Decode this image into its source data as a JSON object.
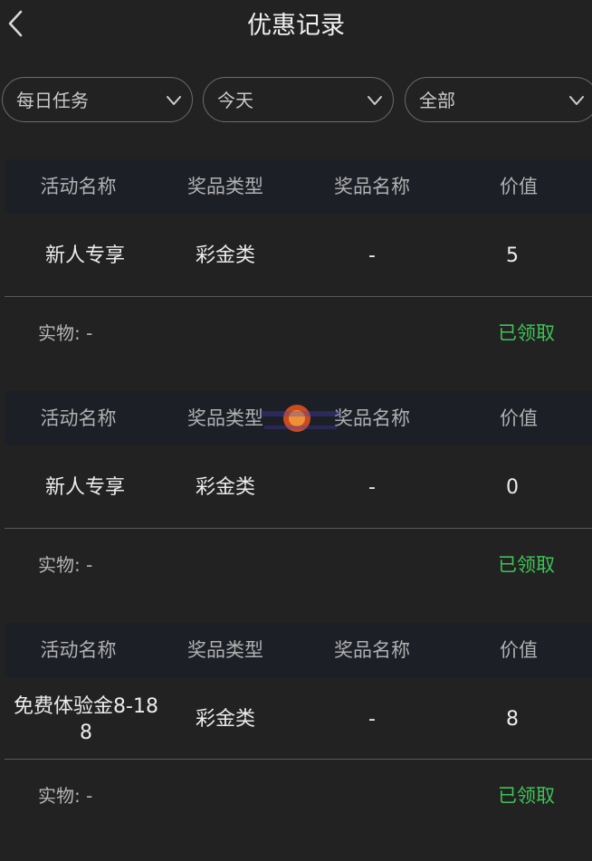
{
  "header": {
    "title": "优惠记录"
  },
  "filters": [
    {
      "label": "每日任务"
    },
    {
      "label": "今天"
    },
    {
      "label": "全部"
    }
  ],
  "table_headers": [
    "活动名称",
    "奖品类型",
    "奖品名称",
    "价值"
  ],
  "records": [
    {
      "headers": [
        "活动名称",
        "奖品类型",
        "奖品名称",
        "价值"
      ],
      "activity": "新人专享",
      "prize_type": "彩金类",
      "prize_name": "-",
      "value": "5",
      "physical_label": "实物:",
      "physical_value": "-",
      "status": "已领取"
    },
    {
      "headers": [
        "活动名称",
        "奖品类型",
        "奖品名称",
        "价值"
      ],
      "activity": "新人专享",
      "prize_type": "彩金类",
      "prize_name": "-",
      "value": "0",
      "physical_label": "实物:",
      "physical_value": "-",
      "status": "已领取"
    },
    {
      "headers": [
        "活动名称",
        "奖品类型",
        "奖品名称",
        "价值"
      ],
      "activity": "免费体验金8-188",
      "prize_type": "彩金类",
      "prize_name": "-",
      "value": "8",
      "physical_label": "实物:",
      "physical_value": "-",
      "status": "已领取"
    }
  ],
  "colors": {
    "background": "#222222",
    "header_row": "#1c1f26",
    "status_green": "#3ec455",
    "divider": "#5a5a5a"
  },
  "icons": {
    "back": "chevron-left-icon",
    "dropdown": "chevron-down-icon",
    "watermark": "watermark-logo-icon"
  }
}
